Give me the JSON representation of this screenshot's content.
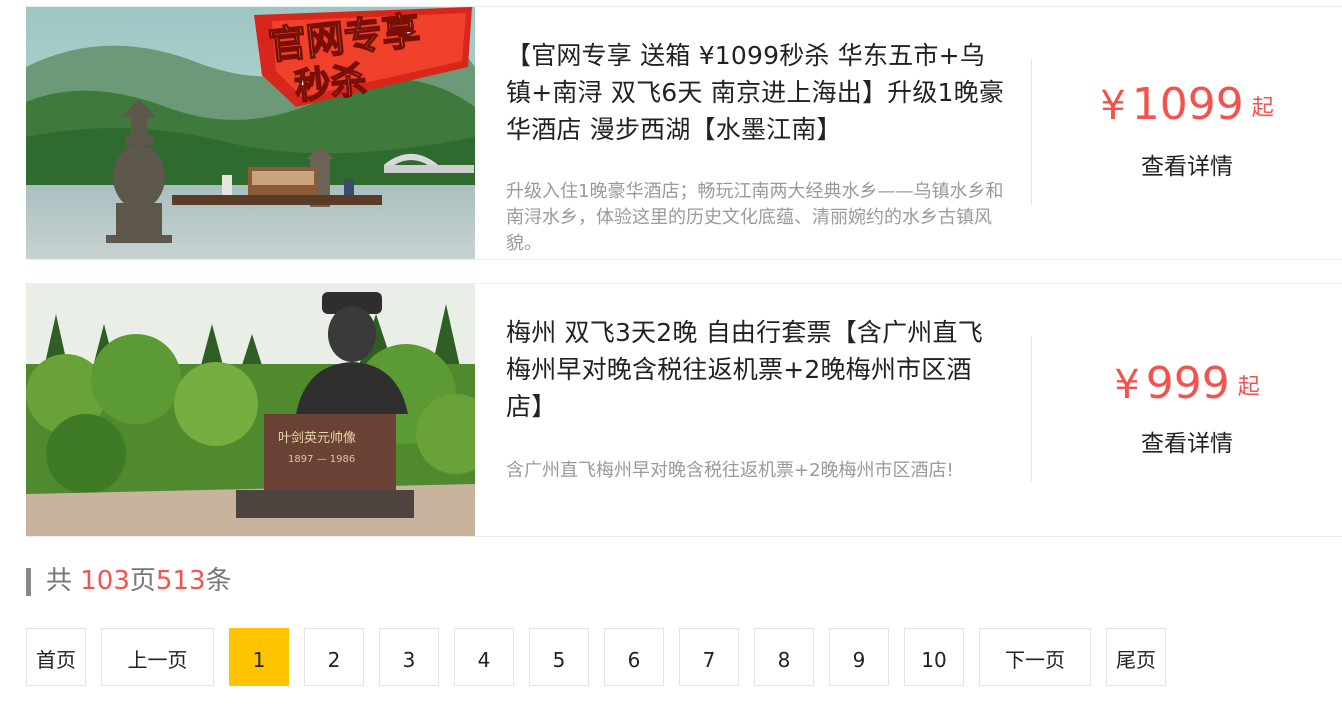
{
  "listings": [
    {
      "title": "【官网专享 送箱 ¥1099秒杀 华东五市+乌镇+南浔 双飞6天 南京进上海出】升级1晚豪华酒店 漫步西湖【水墨江南】",
      "description": "升级入住1晚豪华酒店；畅玩江南两大经典水乡——乌镇水乡和南浔水乡，体验这里的历史文化底蕴、清丽婉约的水乡古镇风貌。",
      "image_banner": "官网专享秒杀",
      "price_currency": "¥",
      "price": "1099",
      "price_suffix": "起",
      "detail_label": "查看详情"
    },
    {
      "title": "梅州 双飞3天2晚 自由行套票【含广州直飞梅州早对晚含税往返机票+2晚梅州市区酒店】",
      "description": "含广州直飞梅州早对晚含税往返机票+2晚梅州市区酒店!",
      "image_plaque": "叶剑英元帅像",
      "price_currency": "¥",
      "price": "999",
      "price_suffix": "起",
      "detail_label": "查看详情"
    }
  ],
  "summary": {
    "prefix": "共 ",
    "pages": "103",
    "pages_unit": "页",
    "count": "513",
    "count_unit": "条"
  },
  "pagination": {
    "first": "首页",
    "prev": "上一页",
    "pages": [
      "1",
      "2",
      "3",
      "4",
      "5",
      "6",
      "7",
      "8",
      "9",
      "10"
    ],
    "current": "1",
    "next": "下一页",
    "last": "尾页"
  },
  "colors": {
    "accent_price": "#f4524d",
    "active_page": "#ffc300"
  }
}
